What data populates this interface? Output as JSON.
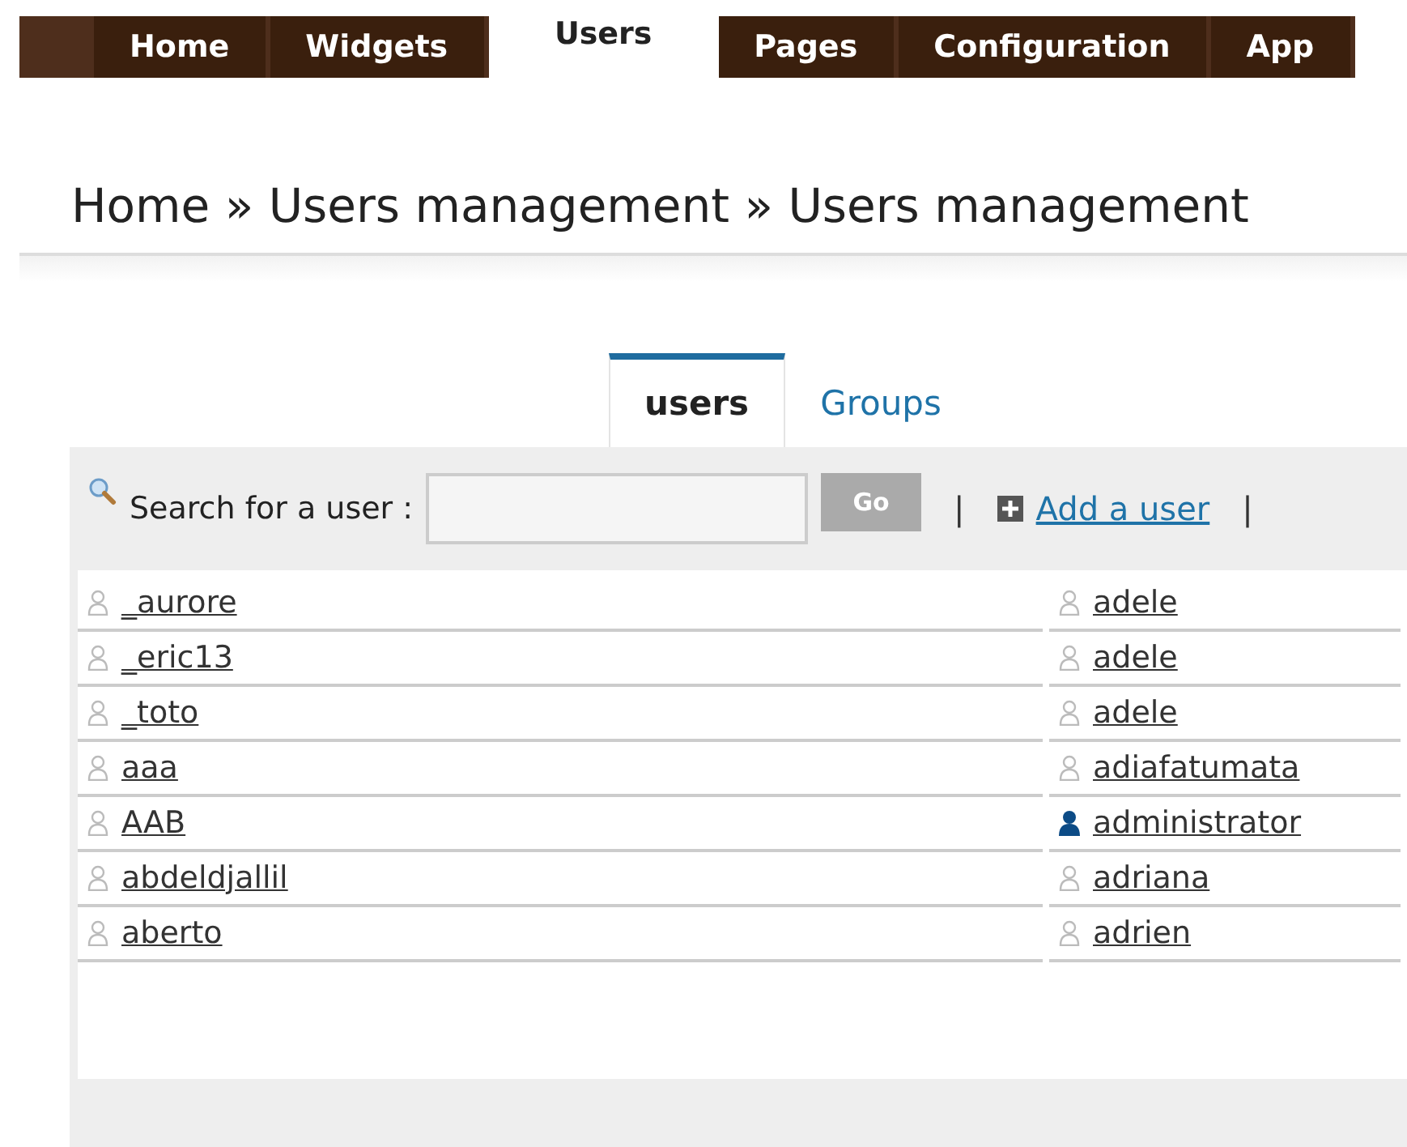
{
  "nav": [
    {
      "label": "Home",
      "selected": false
    },
    {
      "label": "Widgets",
      "selected": false
    },
    {
      "label": "Users",
      "selected": true
    },
    {
      "label": "Pages",
      "selected": false
    },
    {
      "label": "Configuration",
      "selected": false
    },
    {
      "label": "App",
      "selected": false
    }
  ],
  "breadcrumb": "Home » Users management » Users management",
  "tabs": [
    {
      "label": "users",
      "selected": true
    },
    {
      "label": "Groups",
      "selected": false
    }
  ],
  "search": {
    "label": "Search for a user :",
    "button": "Go",
    "separator_1": "|",
    "add_link": "Add a user",
    "separator_2": "|"
  },
  "users": [
    {
      "name": "_aurore",
      "kind": "user"
    },
    {
      "name": "adele",
      "kind": "user"
    },
    {
      "name": "_eric13",
      "kind": "user"
    },
    {
      "name": "adele",
      "kind": "user"
    },
    {
      "name": "_toto",
      "kind": "user"
    },
    {
      "name": "adele",
      "kind": "user"
    },
    {
      "name": "aaa",
      "kind": "user"
    },
    {
      "name": "adiafatumata",
      "kind": "user"
    },
    {
      "name": "AAB",
      "kind": "user"
    },
    {
      "name": "administrator",
      "kind": "admin"
    },
    {
      "name": "abdeldjallil",
      "kind": "user"
    },
    {
      "name": "adriana",
      "kind": "user"
    },
    {
      "name": "aberto",
      "kind": "user"
    },
    {
      "name": "adrien",
      "kind": "user"
    }
  ]
}
